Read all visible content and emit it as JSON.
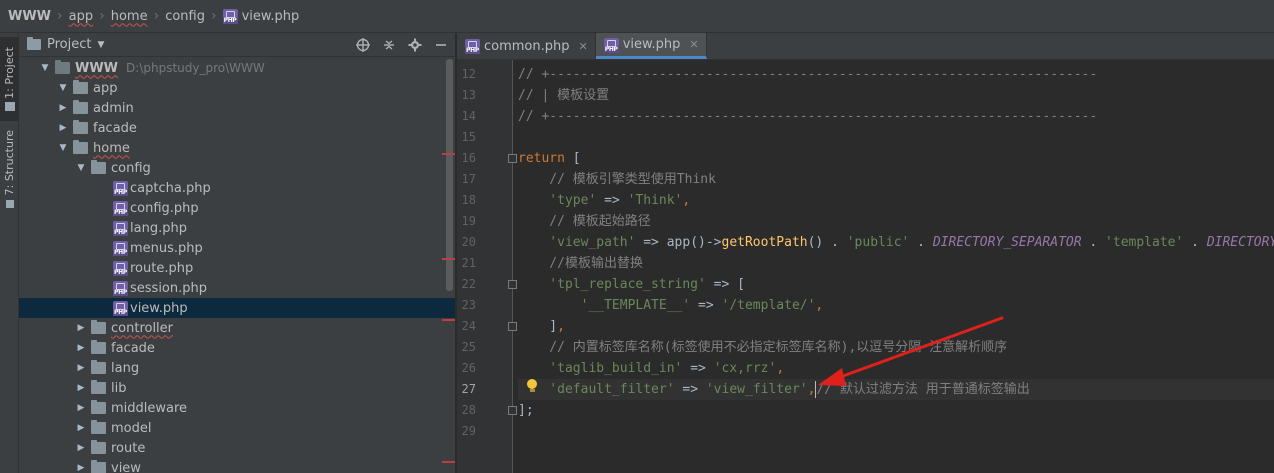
{
  "breadcrumb": {
    "items": [
      "WWW",
      "app",
      "home",
      "config",
      "view.php"
    ]
  },
  "tool_strip": {
    "project_tab": "1: Project",
    "structure_tab": "7: Structure"
  },
  "project_panel": {
    "title": "Project",
    "tools": [
      "globe-icon",
      "collapse-icon",
      "gear-icon",
      "minimize-icon"
    ],
    "tree": [
      {
        "name": "WWW",
        "path": "D:\\phpstudy_pro\\WWW",
        "type": "folder",
        "depth": 0,
        "expanded": true
      },
      {
        "name": "app",
        "type": "folder",
        "depth": 1,
        "expanded": true
      },
      {
        "name": "admin",
        "type": "folder",
        "depth": 2,
        "expanded": false
      },
      {
        "name": "facade",
        "type": "folder",
        "depth": 2,
        "expanded": false
      },
      {
        "name": "home",
        "type": "folder",
        "depth": 2,
        "expanded": true
      },
      {
        "name": "config",
        "type": "folder",
        "depth": 3,
        "expanded": true
      },
      {
        "name": "captcha.php",
        "type": "php",
        "depth": 4
      },
      {
        "name": "config.php",
        "type": "php",
        "depth": 4
      },
      {
        "name": "lang.php",
        "type": "php",
        "depth": 4
      },
      {
        "name": "menus.php",
        "type": "php",
        "depth": 4
      },
      {
        "name": "route.php",
        "type": "php",
        "depth": 4
      },
      {
        "name": "session.php",
        "type": "php",
        "depth": 4
      },
      {
        "name": "view.php",
        "type": "php",
        "depth": 4,
        "selected": true
      },
      {
        "name": "controller",
        "type": "folder",
        "depth": 3,
        "expanded": false
      },
      {
        "name": "facade",
        "type": "folder",
        "depth": 3,
        "expanded": false
      },
      {
        "name": "lang",
        "type": "folder",
        "depth": 3,
        "expanded": false
      },
      {
        "name": "lib",
        "type": "folder",
        "depth": 3,
        "expanded": false
      },
      {
        "name": "middleware",
        "type": "folder",
        "depth": 3,
        "expanded": false
      },
      {
        "name": "model",
        "type": "folder",
        "depth": 3,
        "expanded": false
      },
      {
        "name": "route",
        "type": "folder",
        "depth": 3,
        "expanded": false
      },
      {
        "name": "view",
        "type": "folder",
        "depth": 3,
        "expanded": false
      }
    ]
  },
  "editor": {
    "tabs": [
      {
        "label": "common.php",
        "active": false
      },
      {
        "label": "view.php",
        "active": true
      }
    ],
    "current_line": 27,
    "lines": [
      {
        "no": 12,
        "tokens": [
          [
            "c-comment",
            "// +----------------------------------------------------------------------"
          ]
        ]
      },
      {
        "no": 13,
        "tokens": [
          [
            "c-comment",
            "// | 模板设置"
          ]
        ]
      },
      {
        "no": 14,
        "tokens": [
          [
            "c-comment",
            "// +----------------------------------------------------------------------"
          ]
        ]
      },
      {
        "no": 15,
        "tokens": []
      },
      {
        "no": 16,
        "tokens": [
          [
            "c-kw",
            "return"
          ],
          [
            "c-plain",
            " ["
          ]
        ]
      },
      {
        "no": 17,
        "tokens": [
          [
            "c-comment",
            "    // 模板引擎类型使用Think"
          ]
        ]
      },
      {
        "no": 18,
        "tokens": [
          [
            "c-str",
            "    'type'"
          ],
          [
            "c-plain",
            " => "
          ],
          [
            "c-str",
            "'Think'"
          ],
          [
            "c-kw",
            ","
          ]
        ]
      },
      {
        "no": 19,
        "tokens": [
          [
            "c-comment",
            "    // 模板起始路径"
          ]
        ]
      },
      {
        "no": 20,
        "tokens": [
          [
            "c-str",
            "    'view_path'"
          ],
          [
            "c-plain",
            " => app()->"
          ],
          [
            "c-fn",
            "getRootPath"
          ],
          [
            "c-plain",
            "() . "
          ],
          [
            "c-str",
            "'public'"
          ],
          [
            "c-plain",
            " . "
          ],
          [
            "c-const",
            "DIRECTORY_SEPARATOR"
          ],
          [
            "c-plain",
            " . "
          ],
          [
            "c-str",
            "'template'"
          ],
          [
            "c-plain",
            " . "
          ],
          [
            "c-const",
            "DIRECTORY_SEPARATOR"
          ]
        ]
      },
      {
        "no": 21,
        "tokens": [
          [
            "c-comment",
            "    //模板输出替换"
          ]
        ]
      },
      {
        "no": 22,
        "tokens": [
          [
            "c-str",
            "    'tpl_replace_string'"
          ],
          [
            "c-plain",
            " => ["
          ]
        ]
      },
      {
        "no": 23,
        "tokens": [
          [
            "c-str",
            "        '__TEMPLATE__'"
          ],
          [
            "c-plain",
            " => "
          ],
          [
            "c-str",
            "'/template/'"
          ],
          [
            "c-kw",
            ","
          ]
        ]
      },
      {
        "no": 24,
        "tokens": [
          [
            "c-plain",
            "    ]"
          ],
          [
            "c-kw",
            ","
          ]
        ]
      },
      {
        "no": 25,
        "tokens": [
          [
            "c-comment",
            "    // 内置标签库名称(标签使用不必指定标签库名称),以逗号分隔 注意解析顺序"
          ]
        ]
      },
      {
        "no": 26,
        "tokens": [
          [
            "c-str",
            "    'taglib_build_in'"
          ],
          [
            "c-plain",
            " => "
          ],
          [
            "c-str",
            "'cx,rrz'"
          ],
          [
            "c-kw",
            ","
          ]
        ]
      },
      {
        "no": 27,
        "tokens": [
          [
            "c-str",
            "    'default_filter'"
          ],
          [
            "c-plain",
            " => "
          ],
          [
            "c-str",
            "'view_filter'"
          ],
          [
            "c-kw",
            ","
          ],
          [
            "c-comment",
            "// 默认过滤方法 用于普通标签输出"
          ]
        ]
      },
      {
        "no": 28,
        "tokens": [
          [
            "c-plain",
            "];"
          ]
        ]
      },
      {
        "no": 29,
        "tokens": []
      }
    ]
  },
  "colors": {
    "annotation_arrow": "#e0201d",
    "tab_accent": "#4a88c7"
  }
}
